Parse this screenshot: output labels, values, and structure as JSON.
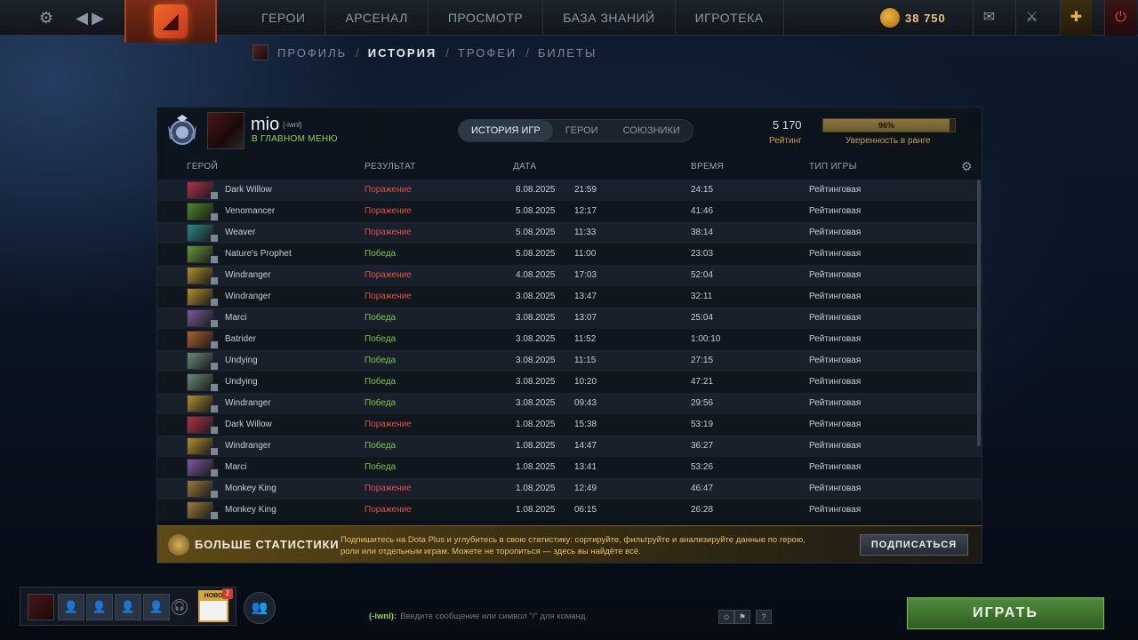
{
  "topbar": {
    "nav": [
      "ГЕРОИ",
      "АРСЕНАЛ",
      "ПРОСМОТР",
      "БАЗА ЗНАНИЙ",
      "ИГРОТЕКА"
    ],
    "shards": "38 750",
    "icons": [
      "gear-icon",
      "back-arrow-icon",
      "forward-arrow-icon",
      "dota-logo",
      "mail-icon",
      "armory-icon",
      "dota-plus-icon",
      "power-icon"
    ]
  },
  "subnav": {
    "profile": "ПРОФИЛЬ",
    "history": "ИСТОРИЯ",
    "trophies": "ТРОФЕИ",
    "tickets": "БИЛЕТЫ",
    "sep": "/"
  },
  "player": {
    "name": "mio",
    "tag": "[-iwnl]",
    "status": "В ГЛАВНОМ МЕНЮ",
    "rating": "5 170",
    "rating_label": "Рейтинг",
    "confidence": "96%",
    "confidence_value": 0.96,
    "confidence_label": "Уверенность в ранге"
  },
  "tabs": [
    "ИСТОРИЯ ИГР",
    "ГЕРОИ",
    "СОЮЗНИКИ"
  ],
  "columns": {
    "hero": "ГЕРОЙ",
    "result": "РЕЗУЛЬТАТ",
    "date": "ДАТА",
    "duration": "ВРЕМЯ",
    "mode": "ТИП ИГРЫ"
  },
  "matches": [
    {
      "hero": "Dark Willow",
      "result": "Поражение",
      "win": false,
      "date": "8.08.2025",
      "time": "21:59",
      "duration": "24:15",
      "mode": "Рейтинговая",
      "color": "#b3304a"
    },
    {
      "hero": "Venomancer",
      "result": "Поражение",
      "win": false,
      "date": "5.08.2025",
      "time": "12:17",
      "duration": "41:46",
      "mode": "Рейтинговая",
      "color": "#4e8a2a"
    },
    {
      "hero": "Weaver",
      "result": "Поражение",
      "win": false,
      "date": "5.08.2025",
      "time": "11:33",
      "duration": "38:14",
      "mode": "Рейтинговая",
      "color": "#2a8a8a"
    },
    {
      "hero": "Nature's Prophet",
      "result": "Победа",
      "win": true,
      "date": "5.08.2025",
      "time": "11:00",
      "duration": "23:03",
      "mode": "Рейтинговая",
      "color": "#6a9a3a"
    },
    {
      "hero": "Windranger",
      "result": "Поражение",
      "win": false,
      "date": "4.08.2025",
      "time": "17:03",
      "duration": "52:04",
      "mode": "Рейтинговая",
      "color": "#b0902a"
    },
    {
      "hero": "Windranger",
      "result": "Поражение",
      "win": false,
      "date": "3.08.2025",
      "time": "13:47",
      "duration": "32:11",
      "mode": "Рейтинговая",
      "color": "#b0902a"
    },
    {
      "hero": "Marci",
      "result": "Победа",
      "win": true,
      "date": "3.08.2025",
      "time": "13:07",
      "duration": "25:04",
      "mode": "Рейтинговая",
      "color": "#7a5aa0"
    },
    {
      "hero": "Batrider",
      "result": "Победа",
      "win": true,
      "date": "3.08.2025",
      "time": "11:52",
      "duration": "1:00:10",
      "mode": "Рейтинговая",
      "color": "#b0602a"
    },
    {
      "hero": "Undying",
      "result": "Победа",
      "win": true,
      "date": "3.08.2025",
      "time": "11:15",
      "duration": "27:15",
      "mode": "Рейтинговая",
      "color": "#6a8a7a"
    },
    {
      "hero": "Undying",
      "result": "Победа",
      "win": true,
      "date": "3.08.2025",
      "time": "10:20",
      "duration": "47:21",
      "mode": "Рейтинговая",
      "color": "#6a8a7a"
    },
    {
      "hero": "Windranger",
      "result": "Победа",
      "win": true,
      "date": "3.08.2025",
      "time": "09:43",
      "duration": "29:56",
      "mode": "Рейтинговая",
      "color": "#b0902a"
    },
    {
      "hero": "Dark Willow",
      "result": "Поражение",
      "win": false,
      "date": "1.08.2025",
      "time": "15:38",
      "duration": "53:19",
      "mode": "Рейтинговая",
      "color": "#b3304a"
    },
    {
      "hero": "Windranger",
      "result": "Победа",
      "win": true,
      "date": "1.08.2025",
      "time": "14:47",
      "duration": "36:27",
      "mode": "Рейтинговая",
      "color": "#b0902a"
    },
    {
      "hero": "Marci",
      "result": "Победа",
      "win": true,
      "date": "1.08.2025",
      "time": "13:41",
      "duration": "53:26",
      "mode": "Рейтинговая",
      "color": "#7a5aa0"
    },
    {
      "hero": "Monkey King",
      "result": "Поражение",
      "win": false,
      "date": "1.08.2025",
      "time": "12:49",
      "duration": "46:47",
      "mode": "Рейтинговая",
      "color": "#a07a3a"
    },
    {
      "hero": "Monkey King",
      "result": "Поражение",
      "win": false,
      "date": "1.08.2025",
      "time": "06:15",
      "duration": "26:28",
      "mode": "Рейтинговая",
      "color": "#a07a3a"
    }
  ],
  "promo": {
    "title": "БОЛЬШЕ СТАТИСТИКИ",
    "text": "Подпишитесь на Dota Plus и углубитесь в свою статистику: сортируйте, фильтруйте и анализируйте данные по герою, роли или отдельным играм. Можете не торопиться — здесь вы найдёте всё.",
    "button": "ПОДПИСАТЬСЯ"
  },
  "bottom": {
    "news_label": "НОВО",
    "news_count": "2",
    "chat_channel": "(-iwnl):",
    "chat_placeholder": "Введите сообщение или символ \"/\" для команд.",
    "play": "ИГРАТЬ",
    "help": "?"
  }
}
